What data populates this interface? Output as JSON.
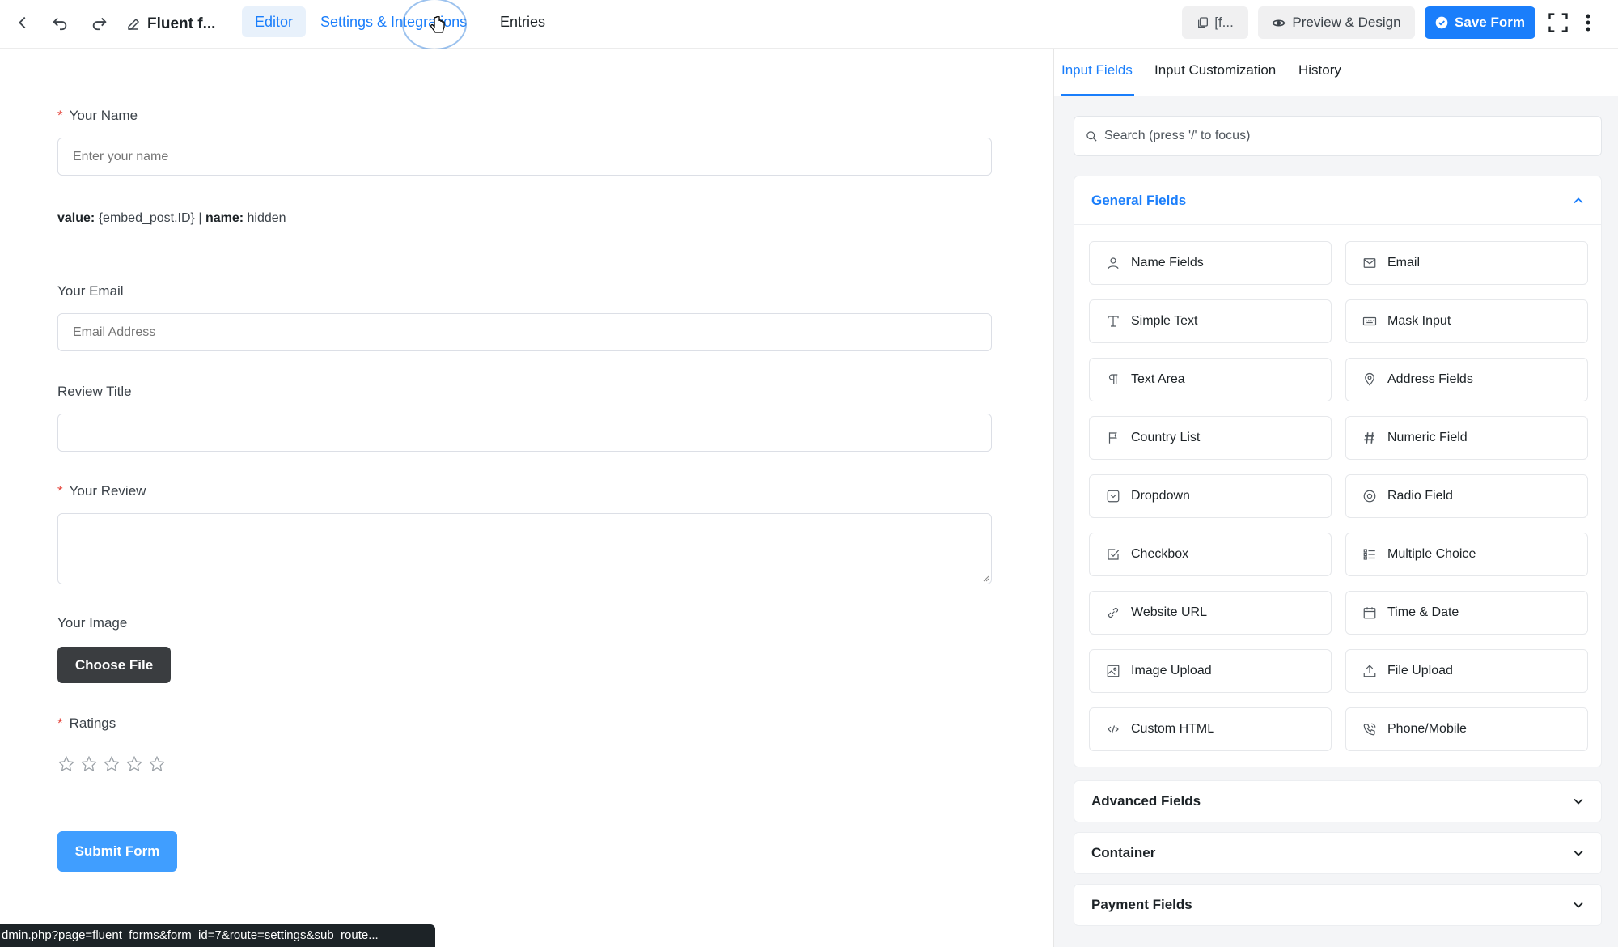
{
  "topbar": {
    "form_name": "Fluent f...",
    "tabs": [
      {
        "label": "Editor"
      },
      {
        "label": "Settings & Integrations"
      },
      {
        "label": "Entries"
      }
    ],
    "shortcode_label": "[f...",
    "preview_label": "Preview & Design",
    "save_label": "Save Form"
  },
  "form": {
    "name_label": "Your Name",
    "name_placeholder": "Enter your name",
    "hidden_value_key": "value:",
    "hidden_value": " {embed_post.ID} | ",
    "hidden_name_key": "name:",
    "hidden_name": " hidden",
    "email_label": "Your Email",
    "email_placeholder": "Email Address",
    "review_title_label": "Review Title",
    "review_label": "Your Review",
    "image_label": "Your Image",
    "choose_file_label": "Choose File",
    "ratings_label": "Ratings",
    "rating_value": 0,
    "rating_max": 5,
    "submit_label": "Submit Form"
  },
  "status_url": "dmin.php?page=fluent_forms&form_id=7&route=settings&sub_route...",
  "panel": {
    "tabs": [
      {
        "label": "Input Fields"
      },
      {
        "label": "Input Customization"
      },
      {
        "label": "History"
      }
    ],
    "search_placeholder": "Search (press '/' to focus)",
    "general_title": "General Fields",
    "general_fields": [
      {
        "label": "Name Fields",
        "icon": "user-icon"
      },
      {
        "label": "Email",
        "icon": "envelope-icon"
      },
      {
        "label": "Simple Text",
        "icon": "text-cursor-icon"
      },
      {
        "label": "Mask Input",
        "icon": "keyboard-icon"
      },
      {
        "label": "Text Area",
        "icon": "paragraph-icon"
      },
      {
        "label": "Address Fields",
        "icon": "map-pin-icon"
      },
      {
        "label": "Country List",
        "icon": "flag-icon"
      },
      {
        "label": "Numeric Field",
        "icon": "hash-icon"
      },
      {
        "label": "Dropdown",
        "icon": "dropdown-icon"
      },
      {
        "label": "Radio Field",
        "icon": "radio-icon"
      },
      {
        "label": "Checkbox",
        "icon": "checkbox-icon"
      },
      {
        "label": "Multiple Choice",
        "icon": "list-icon"
      },
      {
        "label": "Website URL",
        "icon": "link-icon"
      },
      {
        "label": "Time & Date",
        "icon": "calendar-icon"
      },
      {
        "label": "Image Upload",
        "icon": "image-icon"
      },
      {
        "label": "File Upload",
        "icon": "upload-icon"
      },
      {
        "label": "Custom HTML",
        "icon": "code-icon"
      },
      {
        "label": "Phone/Mobile",
        "icon": "phone-icon"
      }
    ],
    "collapsed_sections": [
      {
        "label": "Advanced Fields"
      },
      {
        "label": "Container"
      },
      {
        "label": "Payment Fields"
      }
    ]
  },
  "colors": {
    "accent": "#1a7efb",
    "submit": "#409eff",
    "required": "#e4443b",
    "choose_file_bg": "#3a3d40"
  }
}
